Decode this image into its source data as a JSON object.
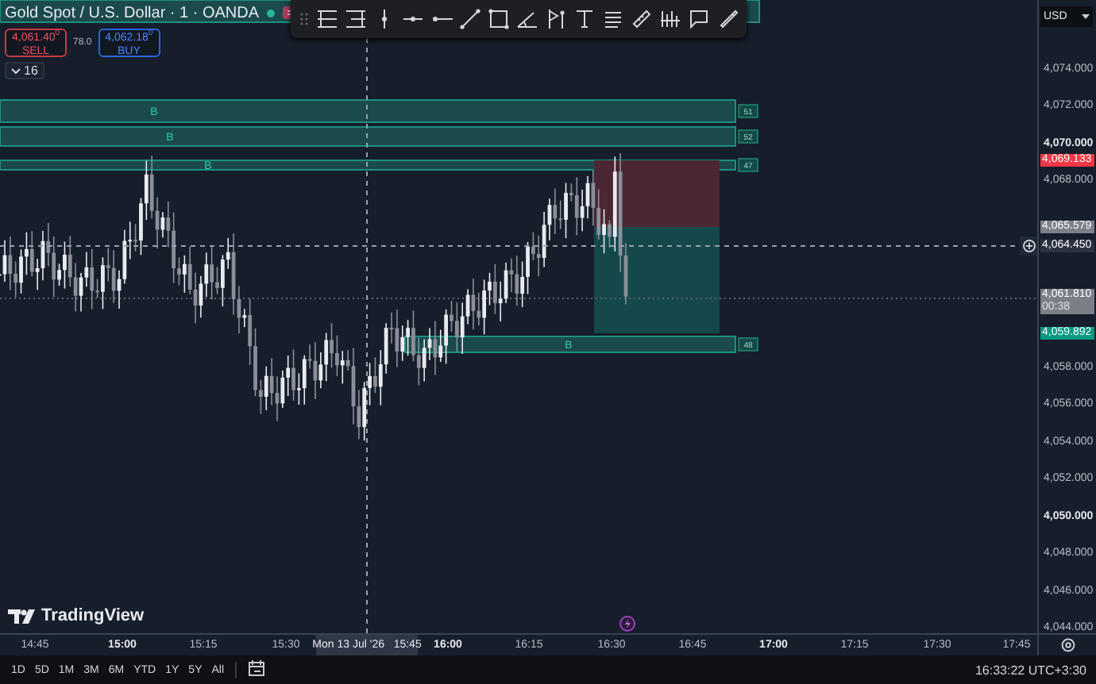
{
  "legend": {
    "symbol": "Gold Spot / U.S. Dollar · 1 · OANDA",
    "sell": {
      "price": "4,061.40$^{0}$",
      "label": "SELL"
    },
    "spread": "78.0",
    "buy": {
      "price": "4,062.18$^{0}$",
      "label": "BUY"
    },
    "indicators": "16"
  },
  "zones": [
    {
      "label": "B",
      "tag": "51"
    },
    {
      "label": "B",
      "tag": "52"
    },
    {
      "label": "B",
      "tag": "47"
    },
    {
      "label": "B",
      "tag": "48"
    }
  ],
  "price_axis": {
    "currency": "USD",
    "ticks": [
      {
        "text": "4,074.000",
        "major": false
      },
      {
        "text": "4,072.000",
        "major": false
      },
      {
        "text": "4,070.000",
        "major": true
      },
      {
        "text": "4,068.000",
        "major": false
      },
      {
        "text": "4,058.000",
        "major": false
      },
      {
        "text": "4,056.000",
        "major": false
      },
      {
        "text": "4,054.000",
        "major": false
      },
      {
        "text": "4,052.000",
        "major": false
      },
      {
        "text": "4,050.000",
        "major": true
      },
      {
        "text": "4,048.000",
        "major": false
      },
      {
        "text": "4,046.000",
        "major": false
      },
      {
        "text": "4,044.000",
        "major": false
      }
    ],
    "badges": [
      {
        "kind": "stop",
        "text": "4,069.133"
      },
      {
        "kind": "entry",
        "text": "4,065.579"
      },
      {
        "kind": "crosshair",
        "text": "4,064.450"
      },
      {
        "kind": "last",
        "text": "4,061.810",
        "countdown": "00:38"
      },
      {
        "kind": "target",
        "text": "4,059.892"
      }
    ]
  },
  "time_axis": {
    "ticks": [
      {
        "text": "14:45",
        "major": false
      },
      {
        "text": "15:00",
        "major": true
      },
      {
        "text": "15:15",
        "major": false
      },
      {
        "text": "15:30",
        "major": false
      },
      {
        "text": "16:00",
        "major": true
      },
      {
        "text": "16:15",
        "major": false
      },
      {
        "text": "16:30",
        "major": false
      },
      {
        "text": "16:45",
        "major": false
      },
      {
        "text": "17:00",
        "major": true
      },
      {
        "text": "17:15",
        "major": false
      },
      {
        "text": "17:30",
        "major": false
      },
      {
        "text": "17:45",
        "major": false
      }
    ],
    "crosshair_label": "Mon 13 Jul '26   15:45"
  },
  "brand": "TradingView",
  "range_buttons": [
    "1D",
    "5D",
    "1M",
    "3M",
    "6M",
    "YTD",
    "1Y",
    "5Y",
    "All"
  ],
  "clock": "16:33:22 UTC+3:30"
}
